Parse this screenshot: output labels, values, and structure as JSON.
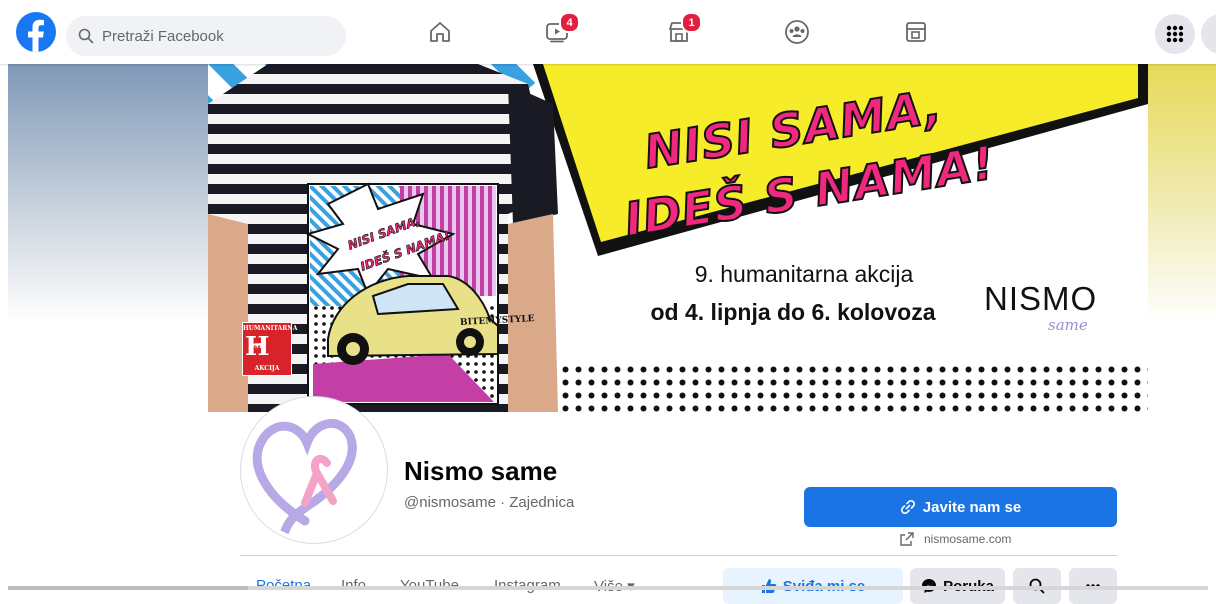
{
  "topbar": {
    "search_placeholder": "Pretraži Facebook",
    "watch_badge": "4",
    "marketplace_badge": "1"
  },
  "cover": {
    "headline_line1": "NISI SAMA,",
    "headline_line2": "IDEŠ S NAMA!",
    "subline1": "9. humanitarna akcija",
    "subline2": "od 4. lipnja do 6. kolovoza",
    "brand": "NISMO",
    "brand_small": "same",
    "shirt_line1": "NISI SAMA,",
    "shirt_line2": "IDEŠ S NAMA!",
    "shirt_brand": "BITEMYSTYLE",
    "stamp_top": "HUMANITARNA",
    "stamp_mid": "OST",
    "stamp_bottom": "AKCIJA",
    "colors": {
      "yellow": "#f7ec2a",
      "pink": "#f0287e",
      "blue": "#3aa1e0"
    }
  },
  "profile": {
    "name": "Nismo same",
    "subtitle": "@nismosame · Zajednica",
    "contact_button": "Javite nam se",
    "website": "nismosame.com"
  },
  "tabs": [
    "Početna",
    "Info",
    "YouTube",
    "Instagram",
    "Više ▾"
  ],
  "actions": {
    "like": "Sviđa mi se",
    "message": "Poruka"
  },
  "icons": {
    "logo": "facebook-logo-icon",
    "search": "search-icon",
    "home": "home-icon",
    "watch": "watch-icon",
    "marketplace": "marketplace-icon",
    "groups": "groups-icon",
    "gaming": "gaming-icon",
    "menu": "menu-grid-icon",
    "link": "link-icon",
    "external": "external-link-icon",
    "like": "thumbs-up-icon",
    "messenger": "messenger-icon",
    "more": "more-dots-icon"
  },
  "colors": {
    "accent": "#1b74e4",
    "badge": "#e41e3f",
    "muted_text": "#65676b"
  }
}
